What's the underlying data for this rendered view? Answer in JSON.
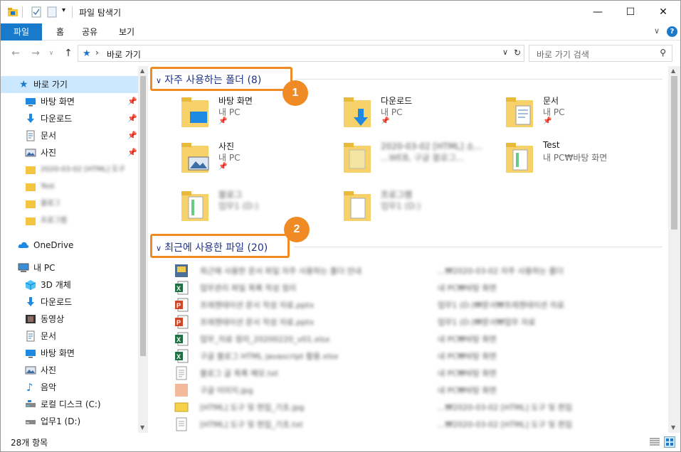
{
  "window": {
    "title": "파일 탐색기",
    "minimize": "—",
    "maximize": "☐",
    "close": "✕"
  },
  "ribbon": {
    "tabs": [
      "파일",
      "홈",
      "공유",
      "보기"
    ],
    "help": "?"
  },
  "address": {
    "path": "바로 가기",
    "search_placeholder": "바로 가기 검색"
  },
  "nav": {
    "quick_access": "바로 가기",
    "pinned": [
      {
        "label": "바탕 화면",
        "icon": "desktop-icon"
      },
      {
        "label": "다운로드",
        "icon": "download-icon"
      },
      {
        "label": "문서",
        "icon": "document-icon"
      },
      {
        "label": "사진",
        "icon": "pictures-icon"
      }
    ],
    "recent_folders": [
      "2020-03-02 [HTML] 도구",
      "Test",
      "블로그",
      "프로그램"
    ],
    "onedrive": "OneDrive",
    "this_pc": "내 PC",
    "pc_items": [
      {
        "label": "3D 개체",
        "icon": "3d-objects-icon"
      },
      {
        "label": "다운로드",
        "icon": "download-icon"
      },
      {
        "label": "동영상",
        "icon": "video-icon"
      },
      {
        "label": "문서",
        "icon": "document-icon"
      },
      {
        "label": "바탕 화면",
        "icon": "desktop-icon"
      },
      {
        "label": "사진",
        "icon": "pictures-icon"
      },
      {
        "label": "음악",
        "icon": "music-icon"
      },
      {
        "label": "로컬 디스크 (C:)",
        "icon": "drive-icon"
      },
      {
        "label": "업무1 (D:)",
        "icon": "drive-icon"
      }
    ]
  },
  "frequent": {
    "header": "자주 사용하는 폴더 (8)",
    "badge": "1",
    "folders": [
      {
        "name": "바탕 화면",
        "sub": "내 PC",
        "pinned": true,
        "blurred": false
      },
      {
        "name": "다운로드",
        "sub": "내 PC",
        "pinned": true,
        "blurred": false
      },
      {
        "name": "문서",
        "sub": "내 PC",
        "pinned": true,
        "blurred": false
      },
      {
        "name": "사진",
        "sub": "내 PC",
        "pinned": true,
        "blurred": false
      },
      {
        "name": "2020-03-02 [HTML] 소...",
        "sub": "...WEB, 구글 블로그...",
        "pinned": false,
        "blurred": true
      },
      {
        "name": "Test",
        "sub": "내 PC₩바탕 화면",
        "pinned": false,
        "blurred": false
      },
      {
        "name": "블로그",
        "sub": "업무1 (D:)",
        "pinned": false,
        "blurred": true
      },
      {
        "name": "프로그램",
        "sub": "업무1 (D:)",
        "pinned": false,
        "blurred": true
      }
    ]
  },
  "recent": {
    "header": "최근에 사용한 파일 (20)",
    "badge": "2",
    "files": [
      {
        "type": "image",
        "name": "최근에 사용한 문서 파일 자주 사용하는 폴더 안내",
        "path": "...₩2020-03-02 자주 사용하는 폴더"
      },
      {
        "type": "excel",
        "name": "업무관리 파일 목록 작성 정리",
        "path": "내 PC₩바탕 화면"
      },
      {
        "type": "ppt",
        "name": "프레젠테이션 문서 작성 자료.pptx",
        "path": "업무1 (D:)₩문서₩프레젠테이션 자료"
      },
      {
        "type": "ppt",
        "name": "프레젠테이션 문서 작성 자료.pptx",
        "path": "업무1 (D:)₩문서₩업무 자료"
      },
      {
        "type": "excel",
        "name": "업무_자료 정리_20200220_v01.xlsx",
        "path": "내 PC₩바탕 화면"
      },
      {
        "type": "excel",
        "name": "구글 블로그 HTML javascript 활용.xlsx",
        "path": "내 PC₩바탕 화면"
      },
      {
        "type": "text",
        "name": "블로그 글 목록 메모.txt",
        "path": "내 PC₩바탕 화면"
      },
      {
        "type": "image2",
        "name": "구글 이미지.jpg",
        "path": "내 PC₩바탕 화면"
      },
      {
        "type": "image3",
        "name": "[HTML] 도구 및 편집_기초.jpg",
        "path": "...₩2020-03-02 [HTML] 도구 및 편집"
      },
      {
        "type": "text",
        "name": "[HTML] 도구 및 편집_기초.txt",
        "path": "...₩2020-03-02 [HTML] 도구 및 편집"
      }
    ]
  },
  "status": {
    "count": "28개 항목"
  },
  "colors": {
    "accent": "#1979ca",
    "highlight": "#f08a24",
    "selection": "#cce8ff",
    "group_header": "#1e3287"
  }
}
